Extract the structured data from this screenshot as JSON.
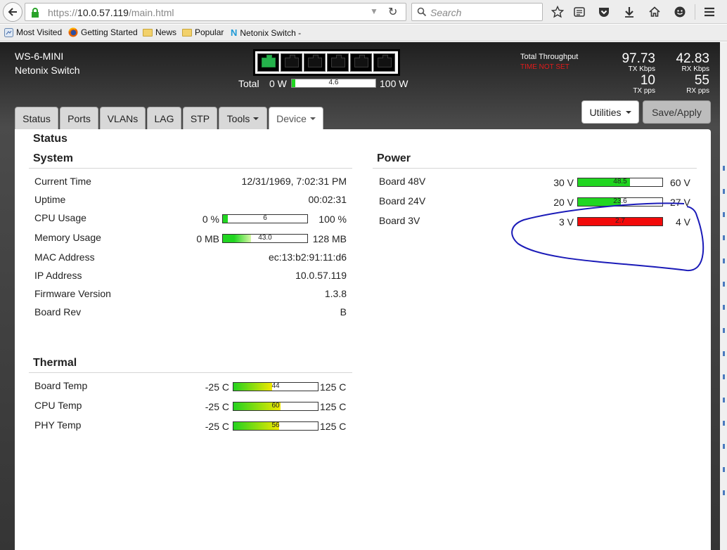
{
  "browser": {
    "url_prefix": "https://",
    "url_host": "10.0.57.119",
    "url_path": "/main.html",
    "search_placeholder": "Search",
    "bookmarks": [
      "Most Visited",
      "Getting Started",
      "News",
      "Popular",
      "Netonix Switch -"
    ]
  },
  "header": {
    "model": "WS-6-MINI",
    "brand": "Netonix Switch",
    "ports": [
      true,
      false,
      false,
      false,
      false,
      false
    ],
    "power": {
      "label": "Total",
      "min": "0 W",
      "value_text": "4.6",
      "value": 4.6,
      "max_value": 100,
      "max": "100 W"
    },
    "throughput": {
      "title": "Total Throughput",
      "warning": "TIME NOT SET",
      "tx_kbps": "97.73",
      "tx_kbps_label": "TX Kbps",
      "rx_kbps": "42.83",
      "rx_kbps_label": "RX Kbps",
      "tx_pps": "10",
      "tx_pps_label": "TX pps",
      "rx_pps": "55",
      "rx_pps_label": "RX pps"
    }
  },
  "tabs": [
    {
      "label": "Status",
      "dropdown": false
    },
    {
      "label": "Ports",
      "dropdown": false
    },
    {
      "label": "VLANs",
      "dropdown": false
    },
    {
      "label": "LAG",
      "dropdown": false
    },
    {
      "label": "STP",
      "dropdown": false
    },
    {
      "label": "Tools",
      "dropdown": true
    },
    {
      "label": "Device",
      "dropdown": true,
      "active": true
    }
  ],
  "buttons": {
    "utilities": "Utilities",
    "save": "Save/Apply"
  },
  "page_title": "Status",
  "system": {
    "title": "System",
    "current_time_label": "Current Time",
    "current_time": "12/31/1969, 7:02:31 PM",
    "uptime_label": "Uptime",
    "uptime": "00:02:31",
    "cpu_label": "CPU Usage",
    "cpu_min": "0 %",
    "cpu_text": "6",
    "cpu_value": 6,
    "cpu_max_value": 100,
    "cpu_max": "100 %",
    "mem_label": "Memory Usage",
    "mem_min": "0 MB",
    "mem_text": "43.0",
    "mem_value": 43.0,
    "mem_max_value": 128,
    "mem_max": "128 MB",
    "mac_label": "MAC Address",
    "mac": "ec:13:b2:91:11:d6",
    "ip_label": "IP Address",
    "ip": "10.0.57.119",
    "fw_label": "Firmware Version",
    "fw": "1.3.8",
    "rev_label": "Board Rev",
    "rev": "B"
  },
  "power": {
    "title": "Power",
    "rows": [
      {
        "label": "Board 48V",
        "min": "30 V",
        "value_text": "48.5",
        "fraction": 0.62,
        "max": "60 V",
        "color": "#21d621"
      },
      {
        "label": "Board 24V",
        "min": "20 V",
        "value_text": "23.6",
        "fraction": 0.51,
        "max": "27 V",
        "color": "#21d621"
      },
      {
        "label": "Board 3V",
        "min": "3 V",
        "value_text": "2.7",
        "fraction": 1.0,
        "max": "4 V",
        "color": "#f20a0a"
      }
    ]
  },
  "thermal": {
    "title": "Thermal",
    "rows": [
      {
        "label": "Board Temp",
        "min": "-25 C",
        "value_text": "44",
        "fraction": 0.46,
        "max": "125 C"
      },
      {
        "label": "CPU Temp",
        "min": "-25 C",
        "value_text": "60",
        "fraction": 0.56,
        "max": "125 C"
      },
      {
        "label": "PHY Temp",
        "min": "-25 C",
        "value_text": "56",
        "fraction": 0.54,
        "max": "125 C"
      }
    ]
  },
  "colors": {
    "ok": "#21d621",
    "bad": "#f20a0a",
    "annotation": "#1b1bb8"
  }
}
